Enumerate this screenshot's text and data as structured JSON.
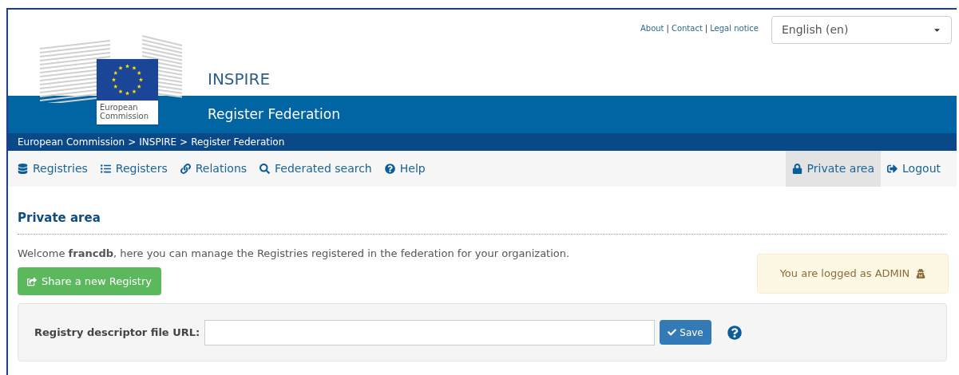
{
  "logo": {
    "lines": [
      "European",
      "Commission"
    ]
  },
  "header": {
    "title": "INSPIRE",
    "subtitle": "Register Federation",
    "top_links": [
      "About",
      "Contact",
      "Legal notice"
    ],
    "top_links_separator": "|",
    "language": {
      "value": "English (en)"
    }
  },
  "breadcrumb": [
    "European Commission",
    "INSPIRE",
    "Register Federation"
  ],
  "breadcrumb_separator": ">",
  "nav": {
    "left": [
      {
        "label": "Registries",
        "selected": false
      },
      {
        "label": "Registers",
        "selected": false
      },
      {
        "label": "Relations",
        "selected": false
      },
      {
        "label": "Federated search",
        "selected": false
      },
      {
        "label": "Help",
        "selected": false
      }
    ],
    "right": [
      {
        "label": "Private area",
        "selected": true
      },
      {
        "label": "Logout",
        "selected": false
      }
    ]
  },
  "page": {
    "heading": "Private area",
    "welcome": "Welcome **francdb**, here you can manage the Registries registered in the federation for your organization.",
    "share_button": "Share a new Registry",
    "alert": "You are logged as ADMIN",
    "form": {
      "label": "Registry descriptor file URL:",
      "save_button": "Save"
    }
  }
}
